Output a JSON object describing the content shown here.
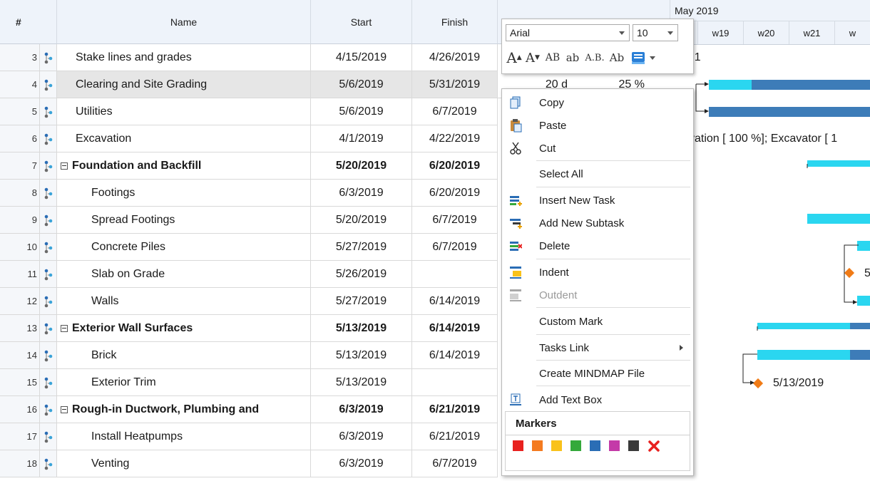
{
  "columns": {
    "num": "#",
    "name": "Name",
    "start": "Start",
    "finish": "Finish"
  },
  "rows": [
    {
      "id": "3",
      "name": "Stake lines and grades",
      "start": "4/15/2019",
      "finish": "4/26/2019",
      "type": "task"
    },
    {
      "id": "4",
      "name": "Clearing and Site Grading",
      "start": "5/6/2019",
      "finish": "5/31/2019",
      "duration": "20 d",
      "pct": "25 %",
      "type": "task",
      "selected": true
    },
    {
      "id": "5",
      "name": "Utilities",
      "start": "5/6/2019",
      "finish": "6/7/2019",
      "type": "task"
    },
    {
      "id": "6",
      "name": "Excavation",
      "start": "4/1/2019",
      "finish": "4/22/2019",
      "type": "task"
    },
    {
      "id": "7",
      "name": "Foundation and Backfill",
      "start": "5/20/2019",
      "finish": "6/20/2019",
      "type": "summary"
    },
    {
      "id": "8",
      "name": "Footings",
      "start": "6/3/2019",
      "finish": "6/20/2019",
      "type": "sub"
    },
    {
      "id": "9",
      "name": "Spread Footings",
      "start": "5/20/2019",
      "finish": "6/7/2019",
      "type": "sub"
    },
    {
      "id": "10",
      "name": "Concrete Piles",
      "start": "5/27/2019",
      "finish": "6/7/2019",
      "type": "sub"
    },
    {
      "id": "11",
      "name": "Slab on Grade",
      "start": "5/26/2019",
      "finish": "",
      "type": "sub"
    },
    {
      "id": "12",
      "name": "Walls",
      "start": "5/27/2019",
      "finish": "6/14/2019",
      "type": "sub"
    },
    {
      "id": "13",
      "name": "Exterior Wall Surfaces",
      "start": "5/13/2019",
      "finish": "6/14/2019",
      "type": "summary"
    },
    {
      "id": "14",
      "name": "Brick",
      "start": "5/13/2019",
      "finish": "6/14/2019",
      "type": "sub"
    },
    {
      "id": "15",
      "name": "Exterior Trim",
      "start": "5/13/2019",
      "finish": "",
      "type": "sub"
    },
    {
      "id": "16",
      "name": "Rough-in Ductwork, Plumbing and",
      "start": "6/3/2019",
      "finish": "6/21/2019",
      "type": "summary"
    },
    {
      "id": "17",
      "name": "Install Heatpumps",
      "start": "6/3/2019",
      "finish": "6/21/2019",
      "type": "sub"
    },
    {
      "id": "18",
      "name": "Venting",
      "start": "6/3/2019",
      "finish": "6/7/2019",
      "type": "sub"
    }
  ],
  "gantt": {
    "month": "May 2019",
    "weeks": [
      "w19",
      "w20",
      "w21",
      "w"
    ],
    "labels": {
      "row3": "r 1",
      "row6": "vation [ 100 %]; Excavator [ 1",
      "row11": "5",
      "row15": "5/13/2019"
    },
    "colors": {
      "progress": "#2ad6f0",
      "bar": "#3d7cb8",
      "milestone": "#f07b16"
    }
  },
  "font_toolbar": {
    "font_name": "Arial",
    "font_size": "10",
    "buttons": [
      "A",
      "A",
      "AB",
      "ab",
      "A.B.",
      "Ab"
    ]
  },
  "context_menu": {
    "items": [
      {
        "label": "Copy",
        "icon": "copy-icon"
      },
      {
        "label": "Paste",
        "icon": "paste-icon"
      },
      {
        "label": "Cut",
        "icon": "cut-icon"
      },
      {
        "label": "Select All"
      },
      {
        "label": "Insert New Task",
        "icon": "insert-task-icon"
      },
      {
        "label": "Add New Subtask",
        "icon": "add-subtask-icon"
      },
      {
        "label": "Delete",
        "icon": "delete-task-icon"
      },
      {
        "label": "Indent",
        "icon": "indent-icon"
      },
      {
        "label": "Outdent",
        "icon": "outdent-icon",
        "disabled": true
      },
      {
        "label": "Custom Mark"
      },
      {
        "label": "Tasks Link",
        "submenu": true
      },
      {
        "label": "Create MINDMAP File"
      },
      {
        "label": "Add Text Box",
        "icon": "text-box-icon"
      }
    ],
    "markers_title": "Markers",
    "marker_colors": [
      "#e8211f",
      "#f47b20",
      "#f9c21b",
      "#34a93b",
      "#2a6db5",
      "#c43aa8",
      "#3a3a3a"
    ]
  }
}
